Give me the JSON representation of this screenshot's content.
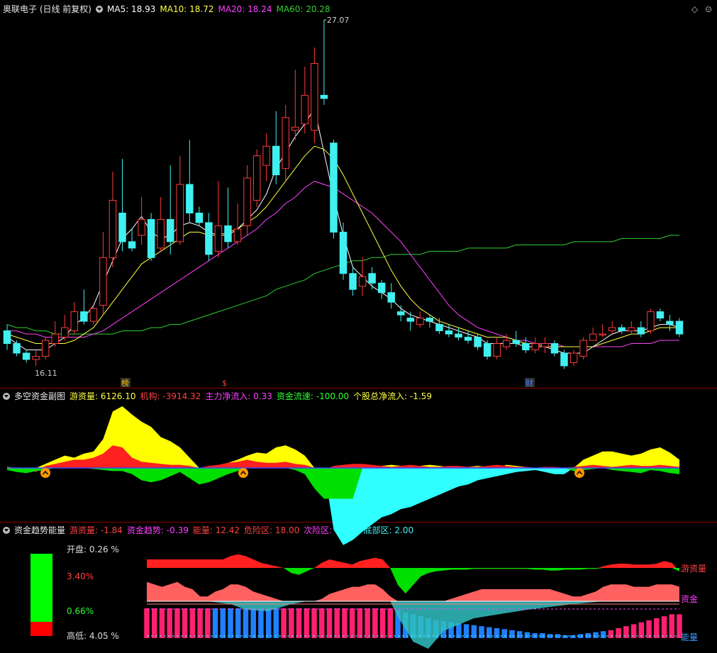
{
  "main": {
    "stock_title": "奥联电子 (日线 前复权)",
    "ma5": "MA5: 18.93",
    "ma10": "MA10: 18.72",
    "ma20": "MA20: 18.24",
    "ma60": "MA60: 20.28",
    "high_label": "27.07",
    "low_label": "16.11",
    "markers": [
      "榜",
      "$",
      "财"
    ],
    "colors": {
      "up": "#ff3b3b",
      "down": "#40f0f0",
      "ma5": "#ffffff",
      "ma10": "#ffff40",
      "ma20": "#ff40ff",
      "ma60": "#30d030"
    }
  },
  "sub1": {
    "title": "多空资金副图",
    "youzi": "游资量: 6126.10",
    "jigou": "机构: -3914.32",
    "zhuli": "主力净流入: 0.33",
    "liusu": "资金流速: -100.00",
    "geigu": "个股总净流入: -1.59"
  },
  "sub2": {
    "title": "资金趋势能量",
    "youzi": "游资量: -1.84",
    "qushi": "资金趋势: -0.39",
    "nengliang": "能量: 12.42",
    "weixian": "危险区: 18.00",
    "ciwei": "次险区: 15.00",
    "dibu": "底部区: 2.00",
    "open_label": "开盘:",
    "open_value": "0.26 %",
    "mid_red": "3.40%",
    "mid_green": "0.66%",
    "hl_label": "高低:",
    "hl_value": "4.05 %",
    "right_labels": [
      "游资量",
      "资金",
      "能量"
    ]
  },
  "chart_data": {
    "type": "candlestick",
    "price_range": [
      16.11,
      27.07
    ],
    "candles": [
      [
        17.3,
        16.9,
        17.5,
        16.7
      ],
      [
        16.9,
        16.6,
        17.0,
        16.5
      ],
      [
        16.6,
        16.4,
        16.7,
        16.3
      ],
      [
        16.4,
        16.5,
        16.7,
        16.2
      ],
      [
        16.5,
        17.0,
        17.1,
        16.4
      ],
      [
        16.9,
        17.2,
        17.6,
        16.8
      ],
      [
        17.1,
        17.4,
        17.8,
        17.0
      ],
      [
        17.3,
        17.9,
        18.2,
        17.2
      ],
      [
        17.9,
        17.6,
        18.6,
        17.5
      ],
      [
        17.6,
        18.0,
        18.1,
        17.5
      ],
      [
        18.1,
        19.6,
        20.4,
        17.8
      ],
      [
        19.6,
        21.4,
        22.3,
        19.3
      ],
      [
        21.0,
        20.1,
        22.7,
        19.8
      ],
      [
        20.1,
        19.9,
        20.5,
        19.8
      ],
      [
        20.3,
        20.8,
        21.5,
        20.0
      ],
      [
        20.8,
        19.6,
        21.0,
        19.5
      ],
      [
        19.9,
        20.8,
        21.5,
        19.8
      ],
      [
        20.8,
        20.1,
        22.5,
        19.7
      ],
      [
        20.1,
        21.9,
        22.8,
        20.0
      ],
      [
        21.9,
        21.0,
        23.3,
        20.7
      ],
      [
        21.0,
        20.7,
        21.2,
        20.6
      ],
      [
        20.7,
        19.7,
        21.0,
        19.5
      ],
      [
        19.8,
        20.6,
        22.0,
        19.6
      ],
      [
        20.6,
        20.1,
        21.8,
        19.9
      ],
      [
        20.1,
        20.5,
        21.3,
        20.0
      ],
      [
        20.6,
        22.1,
        22.5,
        20.3
      ],
      [
        21.4,
        22.8,
        23.0,
        21.2
      ],
      [
        22.5,
        23.1,
        23.5,
        22.0
      ],
      [
        23.1,
        22.2,
        24.2,
        21.9
      ],
      [
        22.4,
        24.0,
        24.4,
        22.0
      ],
      [
        23.6,
        23.7,
        25.5,
        23.3
      ],
      [
        23.8,
        24.7,
        25.6,
        23.5
      ],
      [
        23.6,
        25.7,
        26.2,
        23.2
      ],
      [
        24.7,
        24.6,
        27.07,
        24.4
      ],
      [
        23.2,
        20.4,
        23.3,
        20.2
      ],
      [
        20.4,
        19.1,
        20.7,
        18.9
      ],
      [
        19.1,
        18.6,
        19.3,
        18.4
      ],
      [
        18.7,
        19.0,
        19.6,
        18.4
      ],
      [
        19.1,
        18.8,
        19.3,
        18.6
      ],
      [
        18.8,
        18.5,
        18.9,
        18.3
      ],
      [
        18.5,
        18.2,
        18.8,
        18.0
      ],
      [
        17.9,
        17.8,
        18.1,
        17.6
      ],
      [
        17.7,
        17.6,
        17.9,
        17.3
      ],
      [
        17.5,
        17.7,
        17.9,
        17.4
      ],
      [
        17.7,
        17.6,
        17.8,
        17.4
      ],
      [
        17.5,
        17.3,
        17.7,
        17.2
      ],
      [
        17.3,
        17.2,
        17.5,
        17.1
      ],
      [
        17.2,
        17.1,
        17.4,
        17.0
      ],
      [
        17.1,
        17.0,
        17.3,
        16.9
      ],
      [
        17.1,
        16.8,
        17.2,
        16.7
      ],
      [
        16.9,
        16.5,
        17.0,
        16.4
      ],
      [
        16.5,
        16.9,
        17.1,
        16.4
      ],
      [
        16.8,
        17.0,
        17.2,
        16.7
      ],
      [
        17.0,
        16.9,
        17.3,
        16.8
      ],
      [
        16.9,
        16.7,
        17.1,
        16.6
      ],
      [
        16.7,
        16.9,
        17.1,
        16.6
      ],
      [
        16.8,
        16.9,
        17.1,
        16.6
      ],
      [
        16.9,
        16.6,
        17.0,
        16.5
      ],
      [
        16.6,
        16.2,
        16.7,
        16.1
      ],
      [
        16.3,
        16.6,
        16.7,
        16.2
      ],
      [
        16.5,
        17.0,
        17.1,
        16.4
      ],
      [
        17.0,
        17.2,
        17.4,
        17.0
      ],
      [
        17.2,
        17.2,
        17.5,
        17.1
      ],
      [
        17.3,
        17.4,
        17.6,
        17.2
      ],
      [
        17.4,
        17.3,
        17.5,
        17.2
      ],
      [
        17.3,
        17.4,
        17.6,
        17.2
      ],
      [
        17.4,
        17.2,
        17.6,
        17.1
      ],
      [
        17.3,
        17.9,
        18.0,
        17.2
      ],
      [
        17.9,
        17.7,
        18.0,
        17.6
      ],
      [
        17.6,
        17.5,
        17.8,
        17.3
      ],
      [
        17.6,
        17.2,
        17.7,
        17.1
      ]
    ],
    "ma5": [
      17.1,
      16.9,
      16.7,
      16.7,
      16.7,
      16.9,
      17.1,
      17.5,
      17.7,
      18.1,
      18.8,
      19.5,
      20.2,
      20.5,
      20.9,
      20.4,
      20.2,
      20.3,
      20.6,
      20.7,
      20.6,
      20.4,
      20.3,
      20.3,
      20.5,
      20.8,
      21.1,
      21.6,
      22.4,
      22.9,
      23.4,
      23.8,
      24.3,
      22.9,
      21.5,
      20.3,
      19.3,
      19.0,
      18.7,
      18.5,
      18.3,
      18.0,
      17.8,
      17.7,
      17.6,
      17.5,
      17.4,
      17.3,
      17.2,
      17.1,
      16.9,
      16.9,
      16.9,
      16.9,
      16.8,
      16.8,
      16.8,
      16.7,
      16.6,
      16.6,
      16.6,
      16.8,
      17.0,
      17.2,
      17.3,
      17.3,
      17.3,
      17.4,
      17.5,
      17.5,
      17.4
    ],
    "ma10": [
      17.2,
      17.1,
      17.0,
      16.9,
      16.9,
      16.9,
      16.9,
      17.0,
      17.2,
      17.4,
      17.8,
      18.2,
      18.6,
      19.0,
      19.4,
      19.6,
      19.8,
      20.0,
      20.2,
      20.4,
      20.4,
      20.3,
      20.3,
      20.4,
      20.5,
      20.7,
      20.9,
      21.2,
      21.6,
      22.0,
      22.4,
      22.8,
      23.1,
      23.0,
      22.7,
      22.2,
      21.6,
      21.0,
      20.4,
      19.8,
      19.2,
      18.7,
      18.3,
      18.0,
      17.8,
      17.6,
      17.5,
      17.4,
      17.3,
      17.2,
      17.1,
      17.1,
      17.1,
      17.0,
      16.9,
      16.9,
      16.8,
      16.8,
      16.8,
      16.8,
      16.8,
      16.8,
      16.9,
      17.0,
      17.1,
      17.2,
      17.2,
      17.3,
      17.4,
      17.4,
      17.4
    ],
    "ma20": [
      17.3,
      17.3,
      17.2,
      17.2,
      17.1,
      17.1,
      17.1,
      17.1,
      17.1,
      17.2,
      17.3,
      17.5,
      17.7,
      17.9,
      18.1,
      18.3,
      18.5,
      18.7,
      18.9,
      19.1,
      19.3,
      19.5,
      19.7,
      19.9,
      20.1,
      20.3,
      20.5,
      20.8,
      21.0,
      21.3,
      21.5,
      21.8,
      22.0,
      21.9,
      21.8,
      21.6,
      21.4,
      21.2,
      21.0,
      20.7,
      20.4,
      20.1,
      19.7,
      19.3,
      18.9,
      18.5,
      18.1,
      17.8,
      17.6,
      17.4,
      17.3,
      17.2,
      17.1,
      17.0,
      17.0,
      16.9,
      16.9,
      16.9,
      16.8,
      16.8,
      16.8,
      16.8,
      16.8,
      16.8,
      16.8,
      16.9,
      16.9,
      16.9,
      17.0,
      17.0,
      17.0
    ],
    "ma60": [
      17.5,
      17.4,
      17.4,
      17.3,
      17.3,
      17.2,
      17.2,
      17.2,
      17.2,
      17.2,
      17.2,
      17.2,
      17.3,
      17.3,
      17.3,
      17.4,
      17.4,
      17.5,
      17.5,
      17.6,
      17.7,
      17.8,
      17.9,
      18.0,
      18.1,
      18.2,
      18.3,
      18.4,
      18.6,
      18.7,
      18.8,
      18.9,
      19.1,
      19.2,
      19.3,
      19.4,
      19.5,
      19.5,
      19.6,
      19.6,
      19.7,
      19.7,
      19.7,
      19.7,
      19.8,
      19.8,
      19.8,
      19.8,
      19.9,
      19.9,
      19.9,
      19.9,
      19.9,
      20.0,
      20.0,
      20.0,
      20.0,
      20.0,
      20.0,
      20.1,
      20.1,
      20.1,
      20.1,
      20.1,
      20.2,
      20.2,
      20.2,
      20.2,
      20.2,
      20.3,
      20.3
    ],
    "sub1_yellow": [
      1,
      0,
      0,
      0,
      4,
      8,
      12,
      10,
      14,
      16,
      28,
      55,
      60,
      52,
      45,
      40,
      30,
      26,
      20,
      10,
      0,
      -5,
      0,
      5,
      8,
      12,
      15,
      14,
      20,
      22,
      18,
      12,
      0,
      -10,
      -30,
      -40,
      -20,
      -5,
      0,
      2,
      3,
      2,
      1,
      2,
      3,
      2,
      1,
      0,
      1,
      2,
      1,
      0,
      3,
      2,
      1,
      0,
      1,
      0,
      -2,
      0,
      8,
      12,
      16,
      16,
      14,
      12,
      14,
      18,
      20,
      15,
      8
    ],
    "sub1_red": [
      0,
      0,
      0,
      -4,
      2,
      4,
      6,
      8,
      8,
      10,
      14,
      22,
      20,
      10,
      6,
      5,
      4,
      3,
      3,
      2,
      0,
      2,
      3,
      5,
      6,
      8,
      6,
      5,
      5,
      6,
      4,
      3,
      0,
      -2,
      2,
      3,
      4,
      4,
      3,
      2,
      1,
      2,
      3,
      2,
      1,
      1,
      2,
      2,
      1,
      1,
      2,
      3,
      2,
      1,
      1,
      0,
      1,
      1,
      0,
      1,
      2,
      3,
      2,
      1,
      2,
      3,
      2,
      2,
      3,
      2,
      1
    ],
    "sub1_neg": [
      -2,
      -4,
      -5,
      -3,
      -2,
      0,
      0,
      0,
      0,
      -1,
      -2,
      -3,
      -3,
      -6,
      -12,
      -14,
      -12,
      -8,
      -4,
      -10,
      -16,
      -14,
      -10,
      -6,
      -3,
      0,
      0,
      0,
      0,
      0,
      -2,
      -6,
      -20,
      -30,
      -60,
      -75,
      -70,
      -62,
      -55,
      -48,
      -45,
      -40,
      -38,
      -34,
      -30,
      -26,
      -22,
      -18,
      -16,
      -12,
      -10,
      -8,
      -6,
      -4,
      -3,
      -2,
      -4,
      -6,
      -6,
      -3,
      -2,
      -1,
      0,
      -2,
      -3,
      -4,
      -5,
      -2,
      -3,
      -5,
      -6
    ],
    "sub2_youzi": [
      10,
      10,
      10,
      10,
      10,
      10,
      10,
      10,
      10,
      10,
      10,
      14,
      16,
      14,
      10,
      6,
      4,
      2,
      0,
      -6,
      -8,
      -4,
      0,
      6,
      10,
      8,
      6,
      4,
      8,
      10,
      12,
      10,
      0,
      -20,
      -30,
      -20,
      -10,
      -6,
      -4,
      -3,
      -2,
      -2,
      -2,
      -1,
      -1,
      -1,
      -1,
      -1,
      -1,
      -1,
      -1,
      -2,
      -2,
      -3,
      -3,
      -2,
      -2,
      -2,
      -1,
      -1,
      2,
      4,
      5,
      5,
      4,
      4,
      4,
      5,
      8,
      6,
      -4
    ],
    "sub2_zijin": [
      0.8,
      0.7,
      0.6,
      0.7,
      0.8,
      0.6,
      0.5,
      0.2,
      0.2,
      0.4,
      0.5,
      0.7,
      0.7,
      0.6,
      0.4,
      0.3,
      0.2,
      0.1,
      0.0,
      0.0,
      0.0,
      0.0,
      0.0,
      0.1,
      0.3,
      0.4,
      0.5,
      0.6,
      0.6,
      0.7,
      0.7,
      0.5,
      0.2,
      0.0,
      0.0,
      0.0,
      0.0,
      0.0,
      0.0,
      0.0,
      0.1,
      0.2,
      0.3,
      0.4,
      0.5,
      0.5,
      0.5,
      0.5,
      0.5,
      0.5,
      0.5,
      0.5,
      0.5,
      0.5,
      0.4,
      0.3,
      0.2,
      0.2,
      0.3,
      0.4,
      0.6,
      0.7,
      0.7,
      0.7,
      0.6,
      0.6,
      0.6,
      0.7,
      0.7,
      0.7,
      0.6
    ],
    "sub2_neng": [
      30,
      30,
      30,
      30,
      30,
      30,
      30,
      30,
      30,
      30,
      30,
      30,
      30,
      30,
      30,
      30,
      30,
      30,
      30,
      30,
      30,
      30,
      30,
      30,
      30,
      30,
      30,
      30,
      30,
      30,
      30,
      30,
      30,
      28,
      26,
      24,
      22,
      20,
      18,
      17,
      16,
      15,
      14,
      13,
      12,
      11,
      10,
      9,
      8,
      7,
      6,
      5,
      5,
      4,
      4,
      3,
      3,
      4,
      5,
      6,
      7,
      8,
      10,
      12,
      14,
      16,
      18,
      20,
      22,
      24,
      24
    ]
  }
}
